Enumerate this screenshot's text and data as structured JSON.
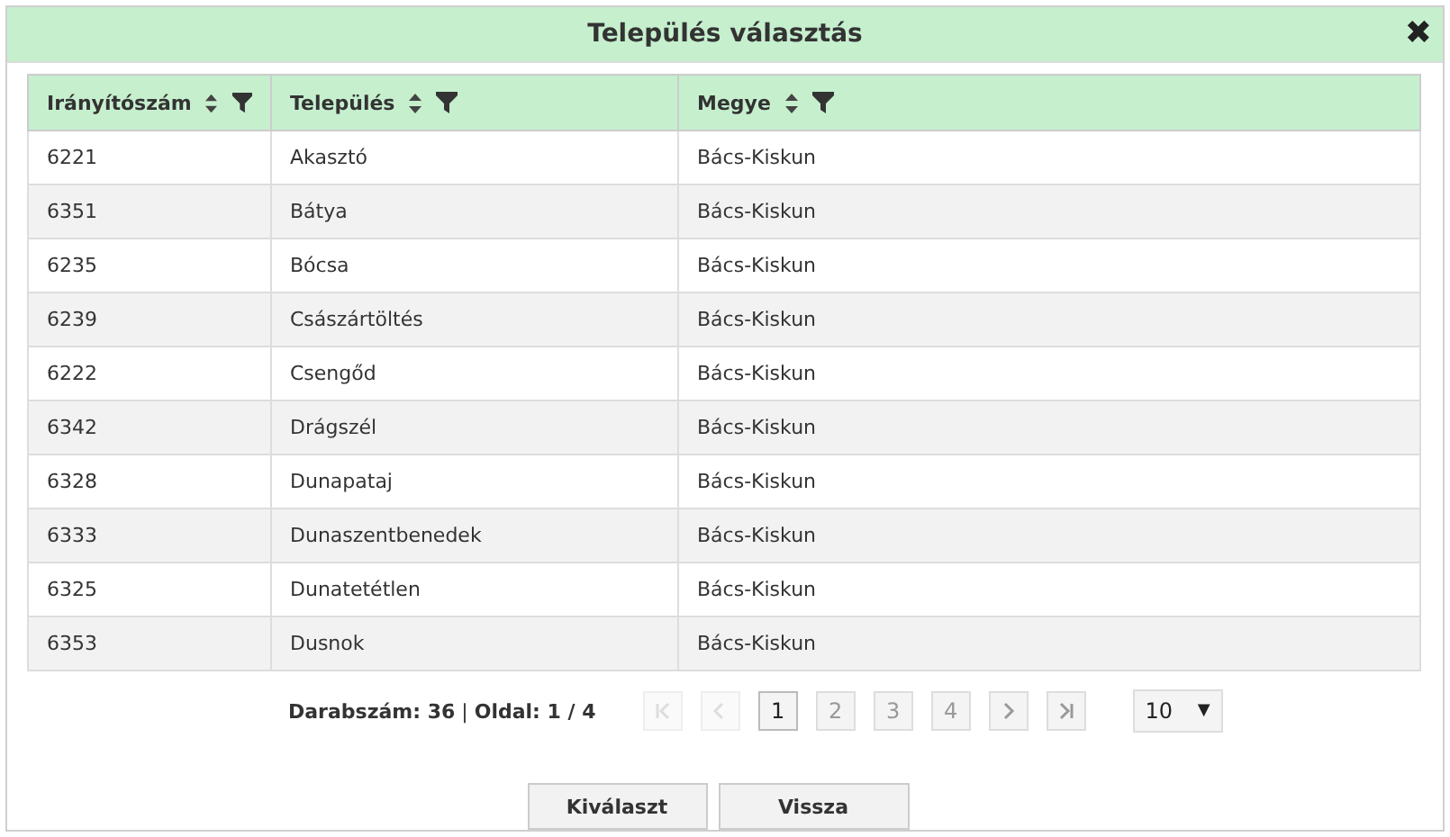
{
  "window": {
    "title": "Település választás",
    "close": "✖"
  },
  "table": {
    "columns": [
      {
        "label": "Irányítószám"
      },
      {
        "label": "Település"
      },
      {
        "label": "Megye"
      }
    ],
    "rows": [
      {
        "cells": [
          "6221",
          "Akasztó",
          "Bács-Kiskun"
        ]
      },
      {
        "cells": [
          "6351",
          "Bátya",
          "Bács-Kiskun"
        ]
      },
      {
        "cells": [
          "6235",
          "Bócsa",
          "Bács-Kiskun"
        ]
      },
      {
        "cells": [
          "6239",
          "Császártöltés",
          "Bács-Kiskun"
        ]
      },
      {
        "cells": [
          "6222",
          "Csengőd",
          "Bács-Kiskun"
        ]
      },
      {
        "cells": [
          "6342",
          "Drágszél",
          "Bács-Kiskun"
        ]
      },
      {
        "cells": [
          "6328",
          "Dunapataj",
          "Bács-Kiskun"
        ]
      },
      {
        "cells": [
          "6333",
          "Dunaszentbenedek",
          "Bács-Kiskun"
        ]
      },
      {
        "cells": [
          "6325",
          "Dunatetétlen",
          "Bács-Kiskun"
        ]
      },
      {
        "cells": [
          "6353",
          "Dusnok",
          "Bács-Kiskun"
        ]
      }
    ]
  },
  "pager": {
    "summary": "**Darabszám: 36** | **Oldal: 1 / 4**",
    "nav": [
      {
        "kind": "first",
        "disabled": true
      },
      {
        "kind": "prev",
        "disabled": true
      },
      {
        "kind": "page",
        "label": "1",
        "selected": true
      },
      {
        "kind": "page",
        "label": "2",
        "selected": false
      },
      {
        "kind": "page",
        "label": "3",
        "selected": false
      },
      {
        "kind": "page",
        "label": "4",
        "selected": false
      },
      {
        "kind": "next",
        "disabled": false
      },
      {
        "kind": "last",
        "disabled": false
      }
    ],
    "page_size": "10",
    "caret": "▼"
  },
  "buttons": [
    "Kiválaszt",
    "Vissza"
  ]
}
